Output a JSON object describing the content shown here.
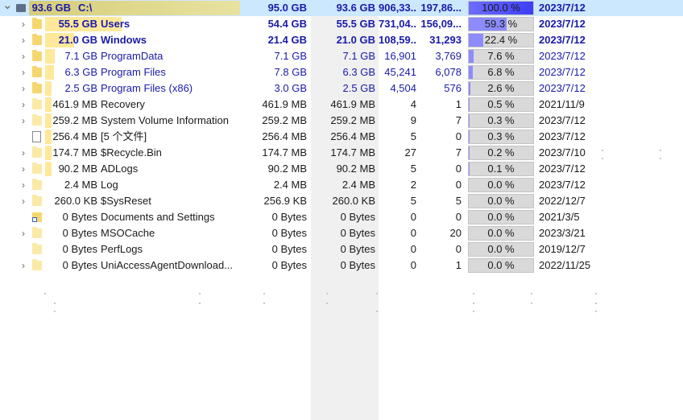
{
  "tree": {
    "rows": [
      {
        "name": "C:\\",
        "size": "93.6 GB",
        "allocated": "95.0 GB",
        "size_col": "93.6 GB",
        "files": "906,33...",
        "subdirs": "197,86...",
        "percent": "100.0 %",
        "percent_value": 100,
        "modified": "2023/7/12",
        "expander": "expanded",
        "icon": "drive-icon",
        "style": "bold-blue",
        "selected": true
      },
      {
        "name": "Users",
        "size": "55.5 GB",
        "allocated": "54.4 GB",
        "size_col": "55.5 GB",
        "files": "731,04...",
        "subdirs": "156,09...",
        "percent": "59.3 %",
        "percent_value": 59.3,
        "modified": "2023/7/12",
        "expander": "collapsed",
        "icon": "folder-icon",
        "style": "bold-blue",
        "selected": false
      },
      {
        "name": "Windows",
        "size": "21.0 GB",
        "allocated": "21.4 GB",
        "size_col": "21.0 GB",
        "files": "108,59...",
        "subdirs": "31,293",
        "percent": "22.4 %",
        "percent_value": 22.4,
        "modified": "2023/7/12",
        "expander": "collapsed",
        "icon": "folder-icon",
        "style": "bold-blue",
        "selected": false
      },
      {
        "name": "ProgramData",
        "size": "7.1 GB",
        "allocated": "7.1 GB",
        "size_col": "7.1 GB",
        "files": "16,901",
        "subdirs": "3,769",
        "percent": "7.6 %",
        "percent_value": 7.6,
        "modified": "2023/7/12",
        "expander": "collapsed",
        "icon": "folder-icon",
        "style": "blue",
        "selected": false
      },
      {
        "name": "Program Files",
        "size": "6.3 GB",
        "allocated": "7.8 GB",
        "size_col": "6.3 GB",
        "files": "45,241",
        "subdirs": "6,078",
        "percent": "6.8 %",
        "percent_value": 6.8,
        "modified": "2023/7/12",
        "expander": "collapsed",
        "icon": "folder-icon",
        "style": "blue",
        "selected": false
      },
      {
        "name": "Program Files (x86)",
        "size": "2.5 GB",
        "allocated": "3.0 GB",
        "size_col": "2.5 GB",
        "files": "4,504",
        "subdirs": "576",
        "percent": "2.6 %",
        "percent_value": 2.6,
        "modified": "2023/7/12",
        "expander": "collapsed",
        "icon": "folder-icon",
        "style": "blue",
        "selected": false
      },
      {
        "name": "Recovery",
        "size": "461.9 MB",
        "allocated": "461.9 MB",
        "size_col": "461.9 MB",
        "files": "4",
        "subdirs": "1",
        "percent": "0.5 %",
        "percent_value": 0.5,
        "modified": "2021/11/9",
        "expander": "collapsed",
        "icon": "folder-icon",
        "style": "normal",
        "selected": false
      },
      {
        "name": "System Volume Information",
        "size": "259.2 MB",
        "allocated": "259.2 MB",
        "size_col": "259.2 MB",
        "files": "9",
        "subdirs": "7",
        "percent": "0.3 %",
        "percent_value": 0.3,
        "modified": "2023/7/12",
        "expander": "collapsed",
        "icon": "folder-icon",
        "style": "normal",
        "selected": false
      },
      {
        "name": "[5 个文件]",
        "size": "256.4 MB",
        "allocated": "256.4 MB",
        "size_col": "256.4 MB",
        "files": "5",
        "subdirs": "0",
        "percent": "0.3 %",
        "percent_value": 0.3,
        "modified": "2023/7/12",
        "expander": "none",
        "icon": "file-icon",
        "style": "normal",
        "selected": false
      },
      {
        "name": "$Recycle.Bin",
        "size": "174.7 MB",
        "allocated": "174.7 MB",
        "size_col": "174.7 MB",
        "files": "27",
        "subdirs": "7",
        "percent": "0.2 %",
        "percent_value": 0.2,
        "modified": "2023/7/10",
        "expander": "collapsed",
        "icon": "folder-icon",
        "style": "normal",
        "selected": false
      },
      {
        "name": "ADLogs",
        "size": "90.2 MB",
        "allocated": "90.2 MB",
        "size_col": "90.2 MB",
        "files": "5",
        "subdirs": "0",
        "percent": "0.1 %",
        "percent_value": 0.1,
        "modified": "2023/7/12",
        "expander": "collapsed",
        "icon": "folder-icon",
        "style": "normal",
        "selected": false
      },
      {
        "name": "Log",
        "size": "2.4 MB",
        "allocated": "2.4 MB",
        "size_col": "2.4 MB",
        "files": "2",
        "subdirs": "0",
        "percent": "0.0 %",
        "percent_value": 0,
        "modified": "2023/7/12",
        "expander": "collapsed",
        "icon": "folder-icon",
        "style": "normal",
        "selected": false
      },
      {
        "name": "$SysReset",
        "size": "260.0 KB",
        "allocated": "256.9 KB",
        "size_col": "260.0 KB",
        "files": "5",
        "subdirs": "5",
        "percent": "0.0 %",
        "percent_value": 0,
        "modified": "2022/12/7",
        "expander": "collapsed",
        "icon": "folder-icon",
        "style": "normal",
        "selected": false
      },
      {
        "name": "Documents and Settings",
        "size": "0 Bytes",
        "allocated": "0 Bytes",
        "size_col": "0 Bytes",
        "files": "0",
        "subdirs": "0",
        "percent": "0.0 %",
        "percent_value": 0,
        "modified": "2021/3/5",
        "expander": "none",
        "icon": "shortcut-folder-icon",
        "style": "normal",
        "selected": false
      },
      {
        "name": "MSOCache",
        "size": "0 Bytes",
        "allocated": "0 Bytes",
        "size_col": "0 Bytes",
        "files": "0",
        "subdirs": "20",
        "percent": "0.0 %",
        "percent_value": 0,
        "modified": "2023/3/21",
        "expander": "collapsed",
        "icon": "folder-icon",
        "style": "normal",
        "selected": false
      },
      {
        "name": "PerfLogs",
        "size": "0 Bytes",
        "allocated": "0 Bytes",
        "size_col": "0 Bytes",
        "files": "0",
        "subdirs": "0",
        "percent": "0.0 %",
        "percent_value": 0,
        "modified": "2019/12/7",
        "expander": "none",
        "icon": "folder-icon",
        "style": "normal",
        "selected": false
      },
      {
        "name": "UniAccessAgentDownload...",
        "size": "0 Bytes",
        "allocated": "0 Bytes",
        "size_col": "0 Bytes",
        "files": "0",
        "subdirs": "1",
        "percent": "0.0 %",
        "percent_value": 0,
        "modified": "2022/11/25",
        "expander": "collapsed",
        "icon": "folder-icon",
        "style": "normal",
        "selected": false
      }
    ]
  },
  "colors": {
    "selection": "#cce8ff",
    "size_bar_root": "#d6cd7a",
    "size_bar": "#ffe89a",
    "percent_fill": "#8c8cff",
    "percent_fill_root": "#3d3df5",
    "percent_track": "#d9d9d9",
    "bold_text": "#1a1aa8"
  }
}
